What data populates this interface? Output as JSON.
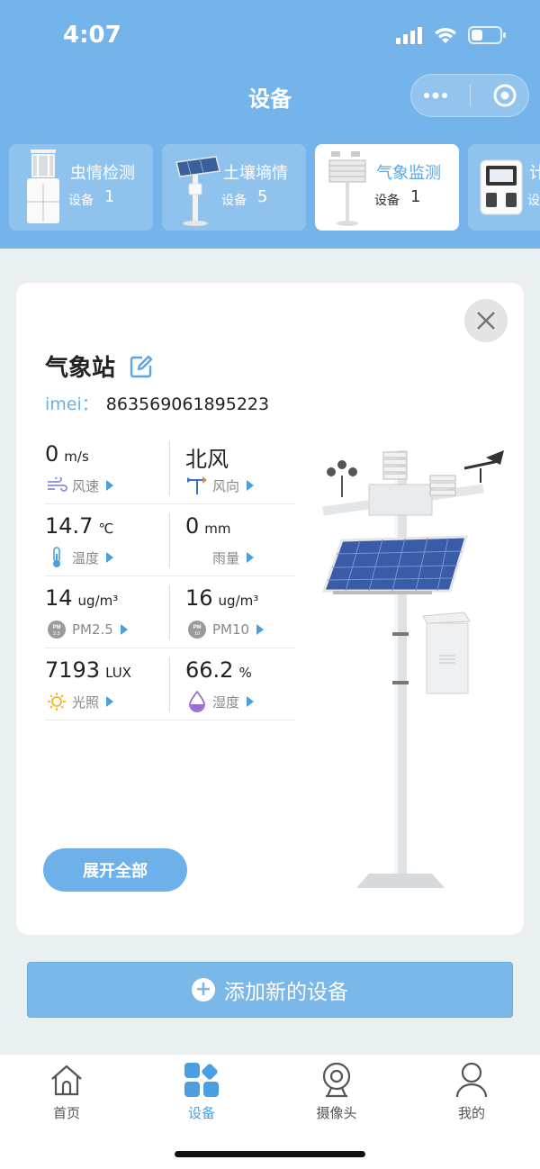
{
  "status_bar": {
    "time": "4:07"
  },
  "page_title": "设备",
  "device_tabs": [
    {
      "name": "虫情检测",
      "count_label": "设备",
      "count": "1"
    },
    {
      "name": "土壤墒情",
      "count_label": "设备",
      "count": "5"
    },
    {
      "name": "气象监测",
      "count_label": "设备",
      "count": "1"
    },
    {
      "name": "计",
      "count_label": "设",
      "count": ""
    }
  ],
  "station": {
    "name": "气象站",
    "imei_label": "imei：",
    "imei_value": "863569061895223"
  },
  "metrics": [
    [
      {
        "value": "0",
        "unit": "m/s",
        "label": "风速",
        "icon": "wind-icon"
      },
      {
        "value": "北风",
        "unit": "",
        "label": "风向",
        "icon": "wind-vane-icon"
      }
    ],
    [
      {
        "value": "14.7",
        "unit": "℃",
        "label": "温度",
        "icon": "thermometer-icon"
      },
      {
        "value": "0",
        "unit": "mm",
        "label": "雨量",
        "icon": ""
      }
    ],
    [
      {
        "value": "14",
        "unit": "ug/m³",
        "label": "PM2.5",
        "icon": "pm25-icon",
        "badge": "PM 2.5"
      },
      {
        "value": "16",
        "unit": "ug/m³",
        "label": "PM10",
        "icon": "pm10-icon",
        "badge": "PM 10"
      }
    ],
    [
      {
        "value": "7193",
        "unit": "LUX",
        "label": "光照",
        "icon": "sun-icon"
      },
      {
        "value": "66.2",
        "unit": "%",
        "label": "湿度",
        "icon": "water-drop-icon"
      }
    ]
  ],
  "expand_label": "展开全部",
  "add_device_label": "添加新的设备",
  "tabbar": [
    {
      "label": "首页",
      "icon": "home-icon"
    },
    {
      "label": "设备",
      "icon": "devices-icon"
    },
    {
      "label": "摄像头",
      "icon": "camera-icon"
    },
    {
      "label": "我的",
      "icon": "user-icon"
    }
  ],
  "colors": {
    "primary": "#74b4ea",
    "accent": "#4a9fe2",
    "background": "#eaeff1"
  }
}
